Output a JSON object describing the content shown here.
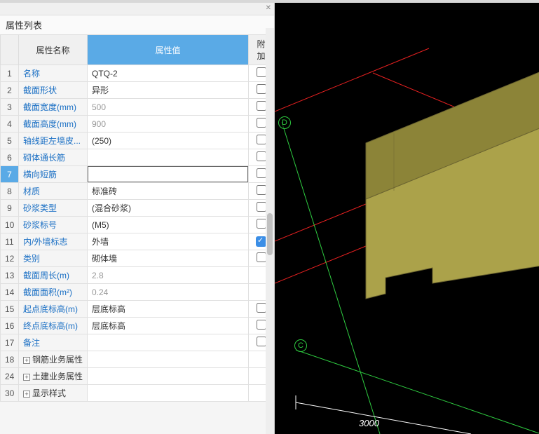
{
  "panel": {
    "title": "属性列表",
    "columns": {
      "name": "属性名称",
      "value": "属性值",
      "attach": "附加"
    }
  },
  "rows": [
    {
      "num": "1",
      "name": "名称",
      "value": "QTQ-2",
      "hasChk": true,
      "blue": true
    },
    {
      "num": "2",
      "name": "截面形状",
      "value": "异形",
      "hasChk": true,
      "blue": true
    },
    {
      "num": "3",
      "name": "截面宽度(mm)",
      "value": "500",
      "hasChk": true,
      "blue": true,
      "dim": true
    },
    {
      "num": "4",
      "name": "截面高度(mm)",
      "value": "900",
      "hasChk": true,
      "blue": true,
      "dim": true
    },
    {
      "num": "5",
      "name": "轴线距左墙皮...",
      "value": "(250)",
      "hasChk": true,
      "blue": true
    },
    {
      "num": "6",
      "name": "砌体通长筋",
      "value": "",
      "hasChk": true,
      "blue": true
    },
    {
      "num": "7",
      "name": "横向短筋",
      "value": "",
      "hasChk": true,
      "blue": true,
      "selected": true
    },
    {
      "num": "8",
      "name": "材质",
      "value": "标准砖",
      "hasChk": true,
      "blue": true
    },
    {
      "num": "9",
      "name": "砂浆类型",
      "value": "(混合砂浆)",
      "hasChk": true,
      "blue": true
    },
    {
      "num": "10",
      "name": "砂浆标号",
      "value": "(M5)",
      "hasChk": true,
      "blue": true
    },
    {
      "num": "11",
      "name": "内/外墙标志",
      "value": "外墙",
      "hasChk": true,
      "blue": true,
      "checked": true
    },
    {
      "num": "12",
      "name": "类别",
      "value": "砌体墙",
      "hasChk": true,
      "blue": true
    },
    {
      "num": "13",
      "name": "截面周长(m)",
      "value": "2.8",
      "hasChk": false,
      "blue": true,
      "dim": true
    },
    {
      "num": "14",
      "name": "截面面积(m²)",
      "value": "0.24",
      "hasChk": false,
      "blue": true,
      "dim": true
    },
    {
      "num": "15",
      "name": "起点底标高(m)",
      "value": "层底标高",
      "hasChk": true,
      "blue": true
    },
    {
      "num": "16",
      "name": "终点底标高(m)",
      "value": "层底标高",
      "hasChk": true,
      "blue": true
    },
    {
      "num": "17",
      "name": "备注",
      "value": "",
      "hasChk": true,
      "blue": true
    },
    {
      "num": "18",
      "name": "钢筋业务属性",
      "value": "",
      "hasChk": false,
      "blue": false,
      "expand": true
    },
    {
      "num": "24",
      "name": "土建业务属性",
      "value": "",
      "hasChk": false,
      "blue": false,
      "expand": true
    },
    {
      "num": "30",
      "name": "显示样式",
      "value": "",
      "hasChk": false,
      "blue": false,
      "expand": true
    }
  ],
  "viewport": {
    "axis_labels": {
      "d": "D",
      "c": "C"
    },
    "dimension": "3000"
  },
  "colors": {
    "header_blue": "#5aaae6",
    "link_blue": "#1a6fc4",
    "grid_green": "#2ecc40",
    "grid_red": "#e62020",
    "wall_fill": "#aba24a"
  }
}
